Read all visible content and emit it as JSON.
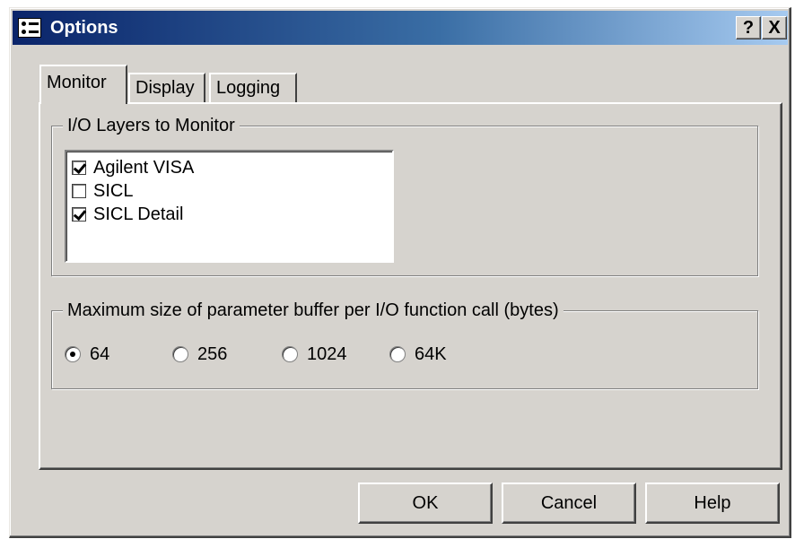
{
  "window": {
    "title": "Options",
    "help_label": "?",
    "close_label": "X"
  },
  "tabs": [
    {
      "label": "Monitor",
      "active": true
    },
    {
      "label": "Display",
      "active": false
    },
    {
      "label": "Logging",
      "active": false
    }
  ],
  "io_layers": {
    "title": "I/O Layers to Monitor",
    "items": [
      {
        "label": "Agilent VISA",
        "checked": true
      },
      {
        "label": "SICL",
        "checked": false
      },
      {
        "label": "SICL Detail",
        "checked": true
      }
    ]
  },
  "buffer": {
    "title": "Maximum size of parameter buffer per I/O function call (bytes)",
    "options": [
      {
        "label": "64",
        "selected": true
      },
      {
        "label": "256",
        "selected": false
      },
      {
        "label": "1024",
        "selected": false
      },
      {
        "label": "64K",
        "selected": false
      }
    ]
  },
  "buttons": {
    "ok": "OK",
    "cancel": "Cancel",
    "help": "Help"
  },
  "colors": {
    "face": "#d6d3ce",
    "title_start": "#0a246a",
    "title_end": "#a6caf0"
  }
}
